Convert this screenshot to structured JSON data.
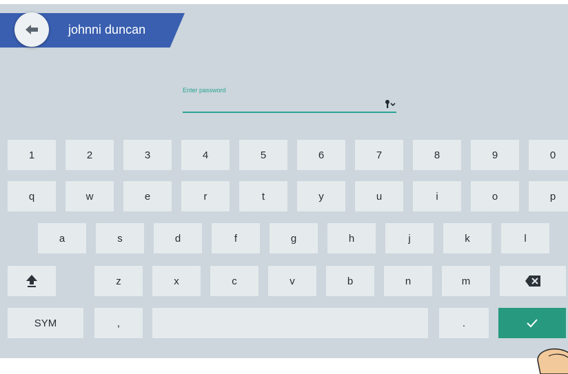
{
  "header": {
    "user_name": "johnni duncan"
  },
  "password": {
    "label": "Enter password",
    "value": ""
  },
  "keyboard": {
    "row_numbers": [
      "1",
      "2",
      "3",
      "4",
      "5",
      "6",
      "7",
      "8",
      "9",
      "0"
    ],
    "row_top": [
      "q",
      "w",
      "e",
      "r",
      "t",
      "y",
      "u",
      "i",
      "o",
      "p"
    ],
    "row_middle": [
      "a",
      "s",
      "d",
      "f",
      "g",
      "h",
      "j",
      "k",
      "l"
    ],
    "row_bottom": [
      "z",
      "x",
      "c",
      "v",
      "b",
      "n",
      "m"
    ],
    "sym_label": "SYM",
    "comma_label": ",",
    "period_label": "."
  },
  "colors": {
    "accent": "#27997f",
    "banner": "#3a5fb0",
    "background": "#ccd6dc",
    "key": "#e5eaed"
  }
}
